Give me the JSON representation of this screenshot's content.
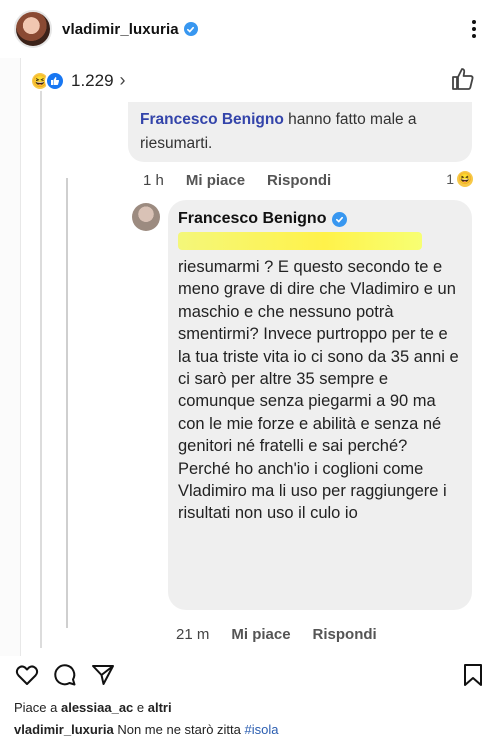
{
  "post": {
    "username": "vladimir_luxuria",
    "verified_icon": "verified-badge-icon",
    "more_icon": "more-options-icon"
  },
  "screenshot": {
    "reactions": {
      "count": "1.229",
      "chevron": "›"
    },
    "parent_comment": {
      "name": "Francesco Benigno",
      "text": "hanno fatto male a riesumarti.",
      "time": "1 h",
      "like_label": "Mi piace",
      "reply_label": "Rispondi",
      "reaction_count": "1"
    },
    "reply_comment": {
      "name": "Francesco Benigno",
      "text": "riesumarmi ? E questo secondo te e meno grave di dire che Vladimiro e un maschio e che nessuno potrà smentirmi? Invece purtroppo per te e la tua triste vita io ci sono da 35 anni e ci sarò per altre 35 sempre e comunque senza piegarmi a 90 ma con le mie forze e abilità e senza né genitori né fratelli e sai perché? Perché ho anch'io i coglioni come Vladimiro ma li uso per raggiungere i risultati non uso il culo io",
      "time": "21 m",
      "like_label": "Mi piace",
      "reply_label": "Rispondi"
    }
  },
  "footer": {
    "likes_prefix": "Piace a ",
    "likes_user": "alessiaa_ac",
    "likes_suffix": " e ",
    "likes_others": "altri",
    "caption_user": "vladimir_luxuria",
    "caption_text": " Non me ne starò zitta ",
    "caption_tag": "#isola"
  },
  "colors": {
    "verified": "#3897f0",
    "highlight": "#fff24a",
    "hashtag": "#2a5db0"
  }
}
